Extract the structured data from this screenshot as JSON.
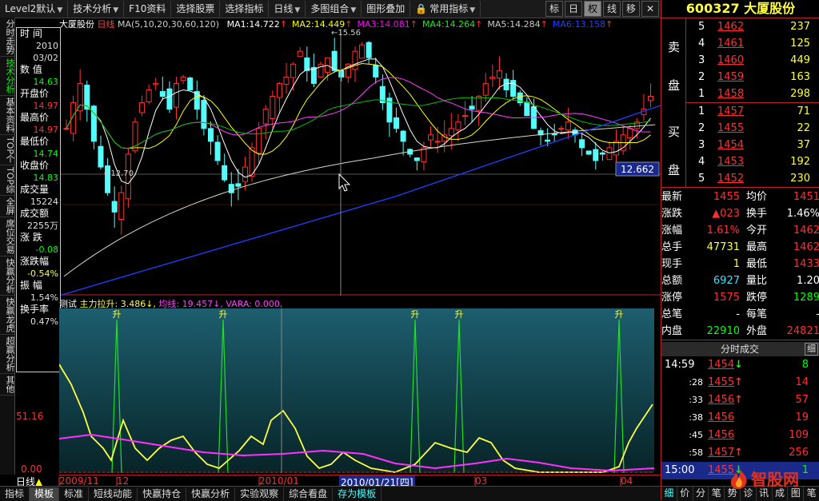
{
  "toolbar": {
    "items": [
      {
        "label": "Level2默认",
        "arrow": true
      },
      {
        "label": "技术分析",
        "arrow": true
      },
      {
        "label": "F10资料",
        "arrow": false
      },
      {
        "label": "选择股票",
        "arrow": false
      },
      {
        "label": "选择指标",
        "arrow": false
      },
      {
        "label": "日线",
        "arrow": true
      },
      {
        "label": "多图组合",
        "arrow": true
      },
      {
        "label": "图形叠加",
        "arrow": false
      },
      {
        "label": "常用指标",
        "arrow": true
      }
    ],
    "buttons": [
      "标",
      "日",
      "权",
      "线",
      "移"
    ]
  },
  "left_tabs": [
    "分时走势",
    "技术分析",
    "基本资料",
    "TOP个",
    "TOP综",
    "全屏",
    "席位交易",
    "快赢分析",
    "快赢龙虎",
    "超赢分析",
    "其他"
  ],
  "data_window": {
    "items": [
      {
        "label": "时  间",
        "value": "2010"
      },
      {
        "label": "",
        "value": "03/02"
      },
      {
        "label": "数  值",
        "value": "14.63"
      },
      {
        "label": "开盘价",
        "value": "14.97"
      },
      {
        "label": "最高价",
        "value": "14.97"
      },
      {
        "label": "最低价",
        "value": "14.74"
      },
      {
        "label": "收盘价",
        "value": "14.83"
      },
      {
        "label": "成交量",
        "value": "15224"
      },
      {
        "label": "成交额",
        "value": "2255万"
      },
      {
        "label": "涨  跌",
        "value": "-0.08"
      },
      {
        "label": "涨跌幅",
        "value": "-0.54%"
      },
      {
        "label": "振  幅",
        "value": "1.54%"
      },
      {
        "label": "换手率",
        "value": "0.47%"
      }
    ]
  },
  "main_chart": {
    "title_stock": "大厦股份",
    "title_period": "日线",
    "ma_spec": "MA(5,10,20,30,60,120)",
    "ma": [
      {
        "name": "MA1:",
        "value": "14.722",
        "color": "#ffffff"
      },
      {
        "name": "MA2:",
        "value": "14.449",
        "color": "#ffff00"
      },
      {
        "name": "MA3:",
        "value": "14.081",
        "color": "#ff00ff"
      },
      {
        "name": "MA4:",
        "value": "14.264",
        "color": "#00ff00"
      },
      {
        "name": "MA5:",
        "value": "14.284",
        "color": "#c8c8c8"
      },
      {
        "name": "MA6:",
        "value": "13.158",
        "color": "#2040ff"
      }
    ],
    "high_label": "15.56",
    "low_label": "12.70",
    "crosshair_value": "12.662",
    "left_price": "15.5"
  },
  "indicator": {
    "name": "测试",
    "line1": "主力拉升: 3.486",
    "line2": "均线: 19.457",
    "line3": "VARA: 0.000,",
    "signal_char": "升",
    "scale_top": "51.16",
    "scale_bottom": "0.00"
  },
  "date_axis": {
    "labels": [
      "2009/11",
      "12",
      "2010/01",
      "03",
      "04"
    ],
    "cursor_date": "2010/01/21",
    "cursor_week": "四"
  },
  "bottom_tabs": [
    "指标",
    "模板",
    "标准",
    "短线动能",
    "快赢持仓",
    "快赢分析",
    "实验观察",
    "综合看盘",
    "存为模板"
  ],
  "period_label": "日线",
  "stock": {
    "code": "600327",
    "name": "大厦股份"
  },
  "order_book": {
    "sell_label": [
      "卖",
      "盘"
    ],
    "buy_label": [
      "买",
      "盘"
    ],
    "sell": [
      {
        "n": "5",
        "p": "1462",
        "v": "237"
      },
      {
        "n": "4",
        "p": "1461",
        "v": "125"
      },
      {
        "n": "3",
        "p": "1460",
        "v": "449"
      },
      {
        "n": "2",
        "p": "1459",
        "v": "163"
      },
      {
        "n": "1",
        "p": "1458",
        "v": "298"
      }
    ],
    "buy": [
      {
        "n": "1",
        "p": "1457",
        "v": "71"
      },
      {
        "n": "2",
        "p": "1455",
        "v": "22"
      },
      {
        "n": "3",
        "p": "1454",
        "v": "37"
      },
      {
        "n": "4",
        "p": "1453",
        "v": "192"
      },
      {
        "n": "5",
        "p": "1452",
        "v": "230"
      }
    ]
  },
  "quote": [
    {
      "l1": "最新",
      "v1": "1455",
      "c1": "#ff3030",
      "l2": "均价",
      "v2": "1451",
      "c2": "#ff3030"
    },
    {
      "l1": "涨跌",
      "v1": "▲023",
      "c1": "#ff3030",
      "l2": "换手",
      "v2": "1.46%",
      "c2": "#ffffff"
    },
    {
      "l1": "涨幅",
      "v1": "1.61%",
      "c1": "#ff3030",
      "l2": "今开",
      "v2": "1462",
      "c2": "#ff3030"
    },
    {
      "l1": "总手",
      "v1": "47731",
      "c1": "#ffff40",
      "l2": "最高",
      "v2": "1462",
      "c2": "#ff3030"
    },
    {
      "l1": "现手",
      "v1": "1",
      "c1": "#ffff40",
      "l2": "最低",
      "v2": "1433",
      "c2": "#ff3030"
    },
    {
      "l1": "总额",
      "v1": "6927",
      "c1": "#40e0ff",
      "l2": "量比",
      "v2": "1.20",
      "c2": "#ffffff"
    },
    {
      "l1": "涨停",
      "v1": "1575",
      "c1": "#ff3030",
      "l2": "跌停",
      "v2": "1289",
      "c2": "#00ff00"
    },
    {
      "l1": "总笔",
      "v1": "-",
      "c1": "#ffffff",
      "l2": "每笔",
      "v2": "-",
      "c2": "#ffffff"
    },
    {
      "l1": "内盘",
      "v1": "22910",
      "c1": "#00ff00",
      "l2": "外盘",
      "v2": "24821",
      "c2": "#ff3030"
    }
  ],
  "ticks": {
    "title": "分时成交",
    "button": "细",
    "rows": [
      {
        "t": "14:59",
        "p": "1454",
        "dir": "down",
        "v": "8"
      },
      {
        "t": ":28",
        "p": "1455",
        "dir": "up",
        "v": "14"
      },
      {
        "t": ":33",
        "p": "1456",
        "dir": "up",
        "v": "57"
      },
      {
        "t": ":38",
        "p": "1456",
        "dir": "",
        "v": "19"
      },
      {
        "t": ":45",
        "p": "1456",
        "dir": "",
        "v": "109"
      },
      {
        "t": ":58",
        "p": "1457",
        "dir": "up",
        "v": "256"
      },
      {
        "t": "15:00",
        "p": "1455",
        "dir": "down",
        "v": "1"
      }
    ]
  },
  "right_bottom_tabs": [
    "细",
    "价",
    "分",
    "笔",
    "势",
    "诊",
    "讯",
    "成",
    "图",
    "笔"
  ],
  "watermark": "智股网"
}
